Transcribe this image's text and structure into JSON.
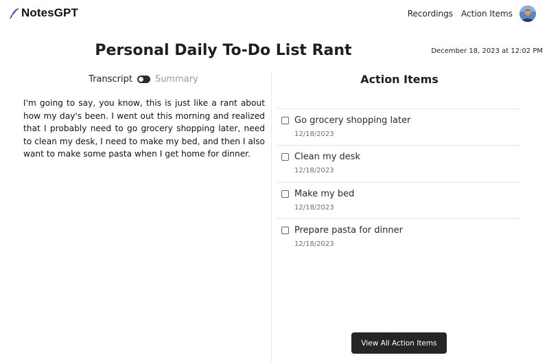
{
  "app": {
    "name": "NotesGPT",
    "logo_icon": "feather-pen-icon"
  },
  "nav": {
    "recordings": "Recordings",
    "action_items": "Action Items",
    "avatar_icon": "user-avatar"
  },
  "note": {
    "title": "Personal Daily To-Do List Rant",
    "timestamp": "December 18, 2023 at 12:02 PM"
  },
  "view_toggle": {
    "left_label": "Transcript",
    "right_label": "Summary",
    "selected": "Transcript"
  },
  "transcript": {
    "text": "I'm going to say, you know, this is just like a rant about how my day's been. I went out this morning and realized that I probably need to go grocery shopping later, need to clean my desk, I need to make my bed, and then I also want to make some pasta when I get home for dinner."
  },
  "action_items": {
    "heading": "Action Items",
    "items": [
      {
        "text": "Go grocery shopping later",
        "date": "12/18/2023",
        "checked": false
      },
      {
        "text": "Clean my desk",
        "date": "12/18/2023",
        "checked": false
      },
      {
        "text": "Make my bed",
        "date": "12/18/2023",
        "checked": false
      },
      {
        "text": "Prepare pasta for dinner",
        "date": "12/18/2023",
        "checked": false
      }
    ],
    "view_all_label": "View All Action Items"
  },
  "colors": {
    "button_bg": "#252525",
    "divider": "#e4e4e4",
    "muted_text": "#9a9a9a"
  }
}
